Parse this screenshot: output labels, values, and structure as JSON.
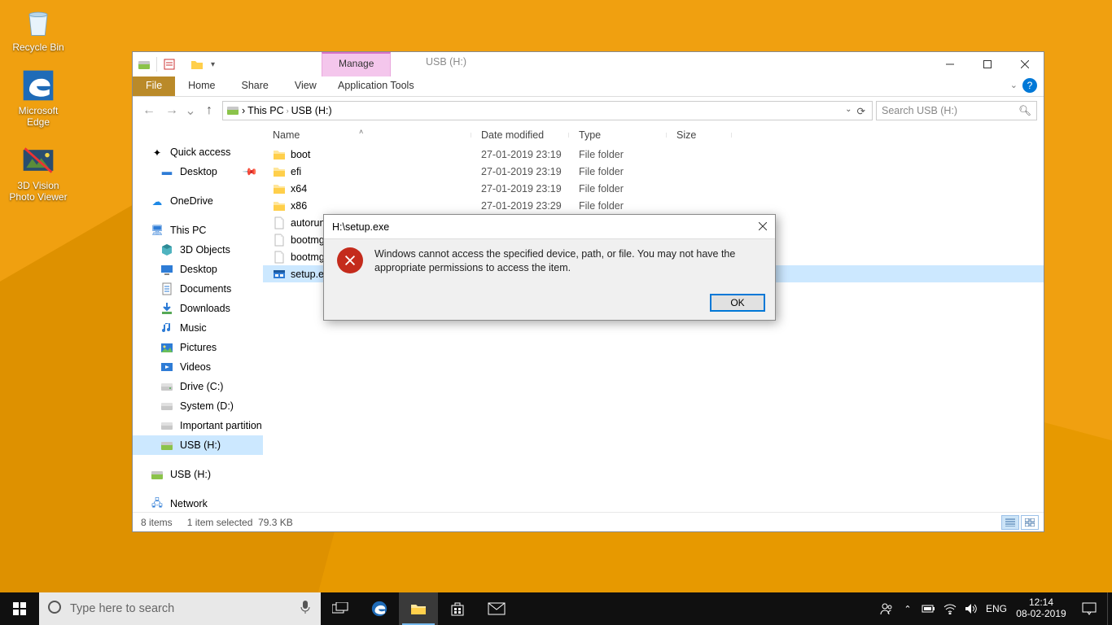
{
  "desktop": {
    "items": [
      {
        "label": "Recycle Bin"
      },
      {
        "label": "Microsoft Edge"
      },
      {
        "label": "3D Vision Photo Viewer"
      }
    ]
  },
  "explorer": {
    "title": "USB (H:)",
    "context_tab": "Manage",
    "context_group": "Application Tools",
    "ribbon": {
      "file": "File",
      "home": "Home",
      "share": "Share",
      "view": "View"
    },
    "breadcrumbs": [
      "This PC",
      "USB (H:)"
    ],
    "search_placeholder": "Search USB (H:)",
    "columns": {
      "name": "Name",
      "date": "Date modified",
      "type": "Type",
      "size": "Size"
    },
    "nav": {
      "quick_access": "Quick access",
      "desktop": "Desktop",
      "onedrive": "OneDrive",
      "this_pc": "This PC",
      "pc_children": [
        "3D Objects",
        "Desktop",
        "Documents",
        "Downloads",
        "Music",
        "Pictures",
        "Videos",
        "Drive (C:)",
        "System (D:)",
        "Important partition",
        "USB (H:)"
      ],
      "usb_dup": "USB (H:)",
      "network": "Network"
    },
    "files": [
      {
        "name": "boot",
        "date": "27-01-2019 23:19",
        "type": "File folder",
        "icon": "folder"
      },
      {
        "name": "efi",
        "date": "27-01-2019 23:19",
        "type": "File folder",
        "icon": "folder"
      },
      {
        "name": "x64",
        "date": "27-01-2019 23:19",
        "type": "File folder",
        "icon": "folder"
      },
      {
        "name": "x86",
        "date": "27-01-2019 23:29",
        "type": "File folder",
        "icon": "folder"
      },
      {
        "name": "autorun",
        "date": "",
        "type": "",
        "icon": "file"
      },
      {
        "name": "bootmgr",
        "date": "",
        "type": "",
        "icon": "file"
      },
      {
        "name": "bootmgr",
        "date": "",
        "type": "",
        "icon": "file"
      },
      {
        "name": "setup.exe",
        "date": "",
        "type": "",
        "icon": "exe",
        "selected": true
      }
    ],
    "status": {
      "count": "8 items",
      "selected": "1 item selected",
      "size": "79.3 KB"
    }
  },
  "dialog": {
    "title": "H:\\setup.exe",
    "message": "Windows cannot access the specified device, path, or file. You may not have the appropriate permissions to access the item.",
    "ok": "OK"
  },
  "taskbar": {
    "search_placeholder": "Type here to search",
    "lang": "ENG",
    "time": "12:14",
    "date": "08-02-2019"
  }
}
